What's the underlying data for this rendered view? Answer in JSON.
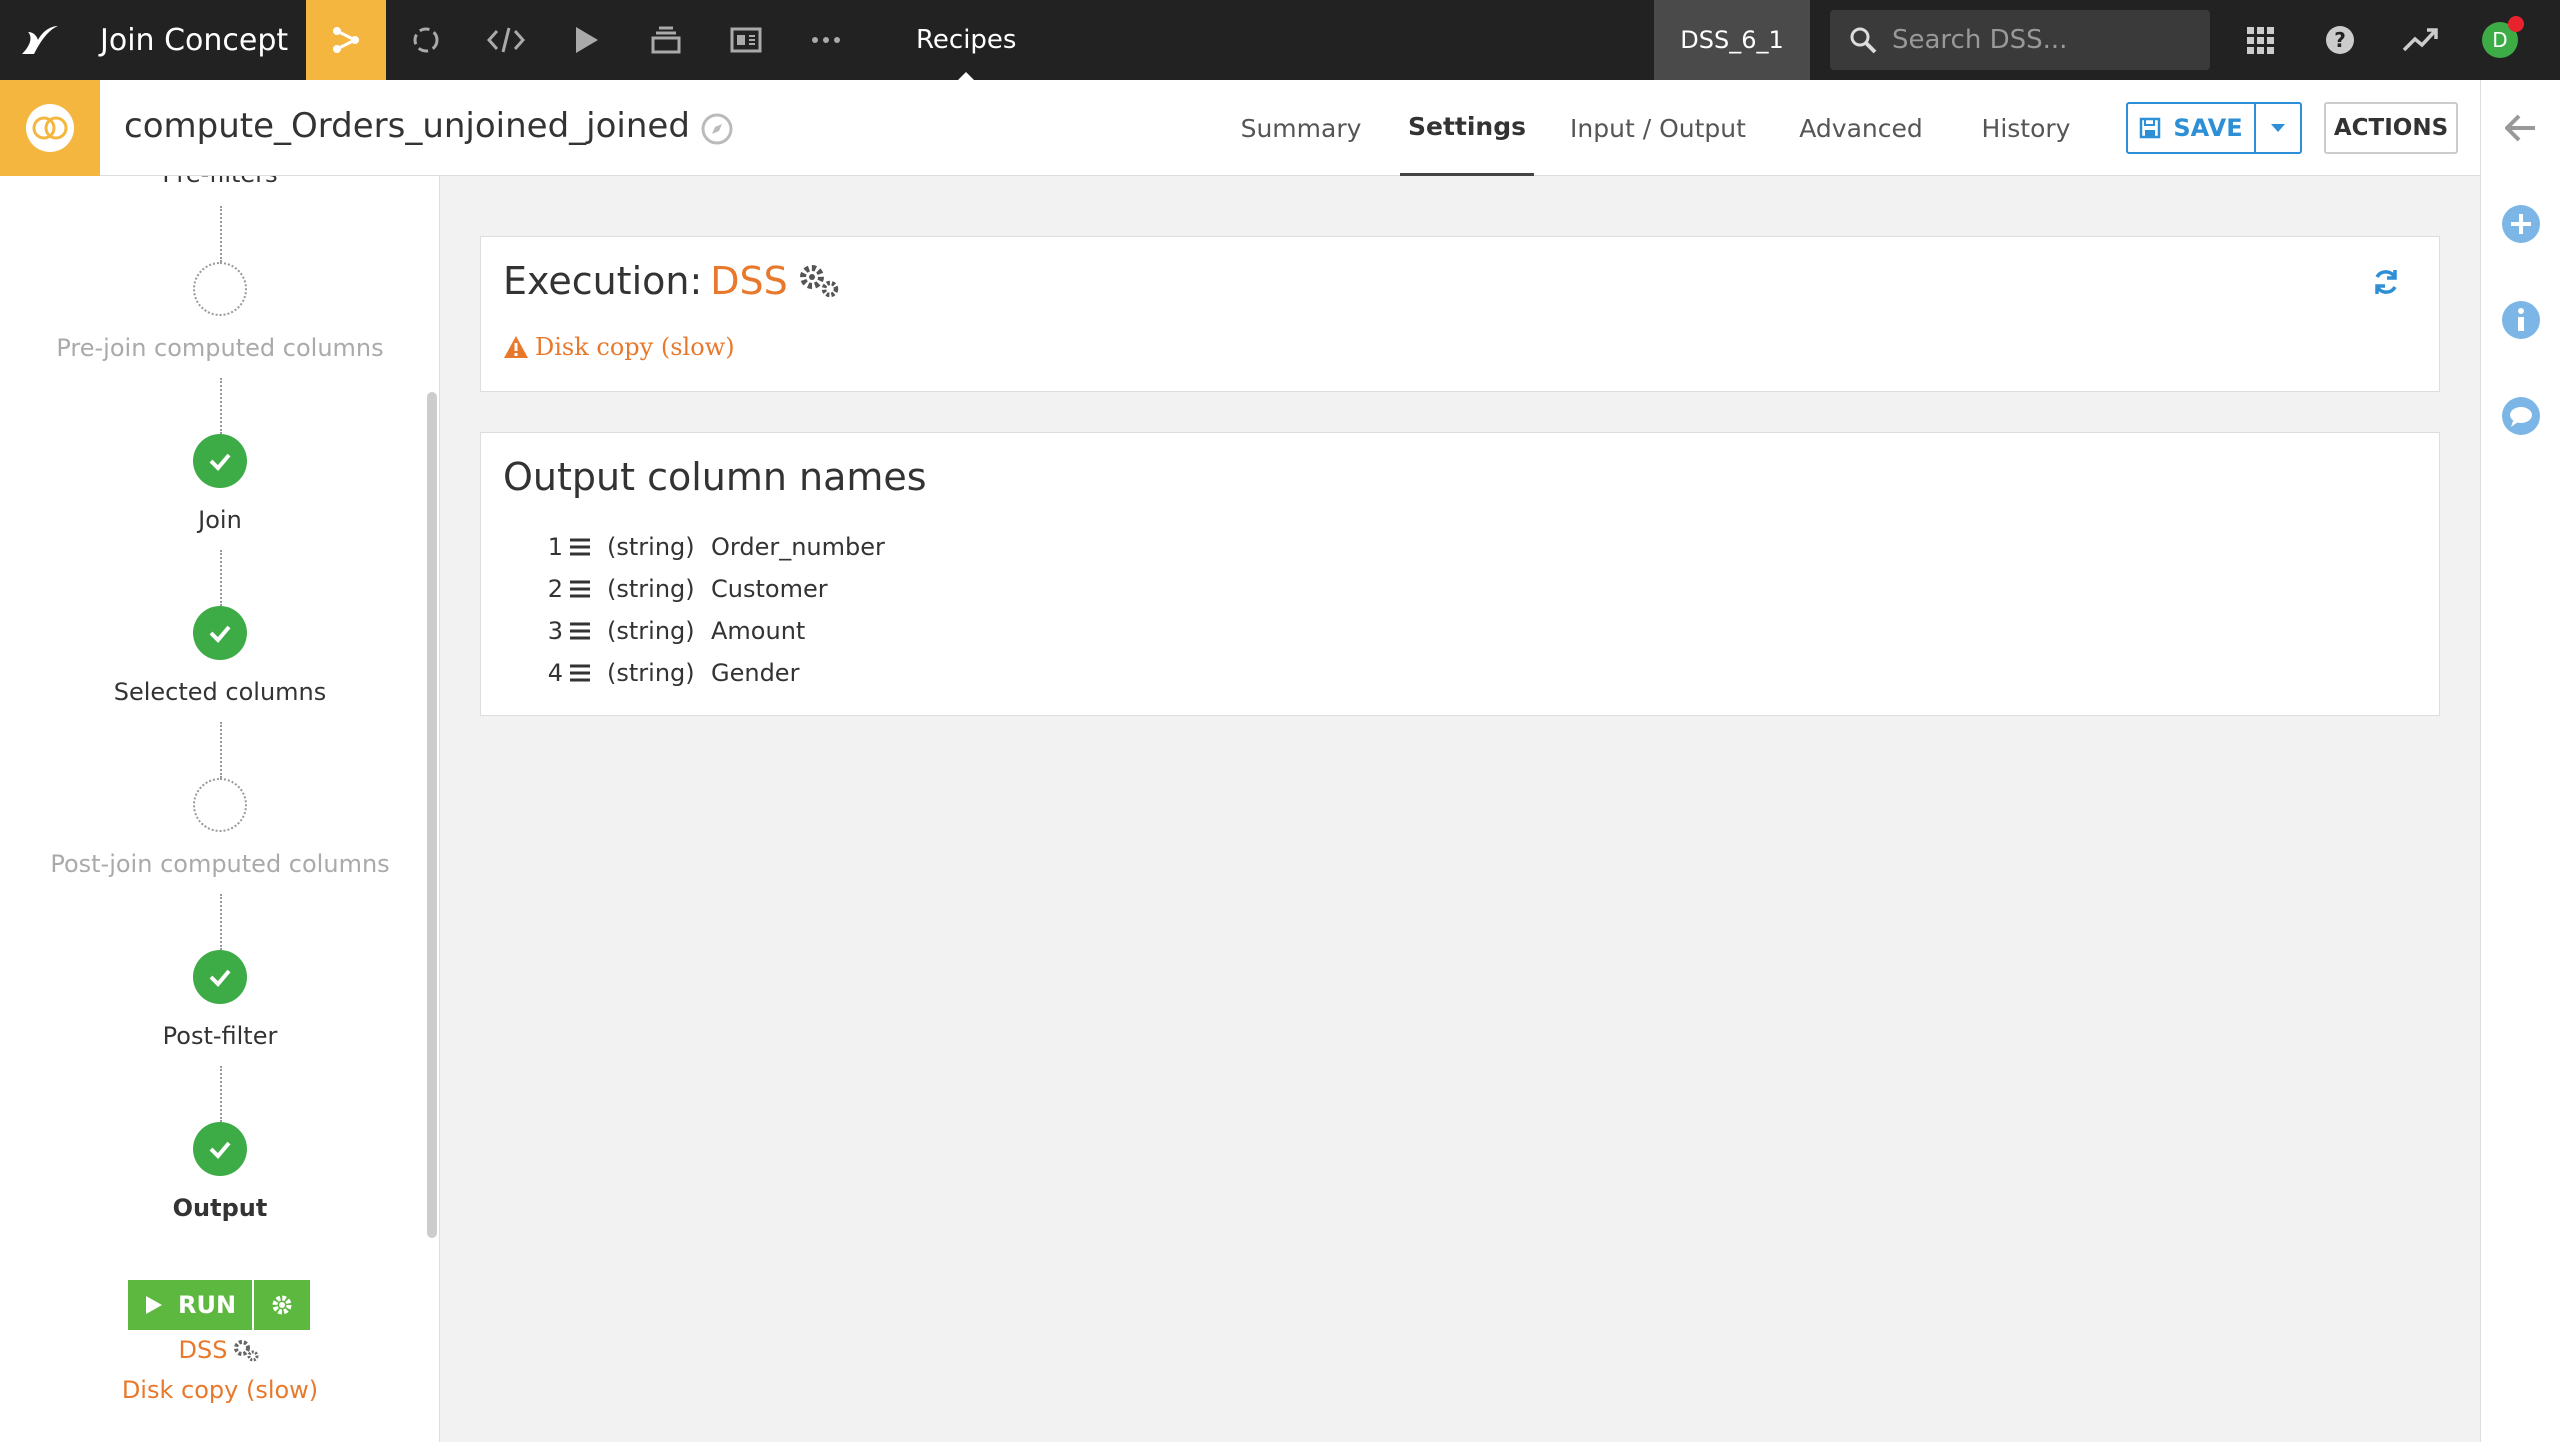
{
  "topnav": {
    "project_title": "Join Concept",
    "section": "Recipes",
    "instance": "DSS_6_1",
    "search_placeholder": "Search DSS...",
    "avatar_initial": "D"
  },
  "recipe": {
    "name": "compute_Orders_unjoined_joined",
    "tabs": [
      "Summary",
      "Settings",
      "Input / Output",
      "Advanced",
      "History"
    ],
    "active_tab": "Settings",
    "save_label": "SAVE",
    "actions_label": "ACTIONS"
  },
  "steps": [
    {
      "label": "Pre-filters",
      "state": "partial"
    },
    {
      "label": "Pre-join computed columns",
      "state": "empty"
    },
    {
      "label": "Join",
      "state": "done"
    },
    {
      "label": "Selected columns",
      "state": "done"
    },
    {
      "label": "Post-join computed columns",
      "state": "empty"
    },
    {
      "label": "Post-filter",
      "state": "done"
    },
    {
      "label": "Output",
      "state": "done",
      "selected": true
    }
  ],
  "run": {
    "label": "RUN",
    "engine": "DSS",
    "engine_note": "Disk copy (slow)"
  },
  "execution": {
    "title_prefix": "Execution:",
    "engine": "DSS",
    "warning": "Disk copy (slow)"
  },
  "output": {
    "title": "Output column names",
    "columns": [
      {
        "index": "1",
        "type": "(string)",
        "name": "Order_number"
      },
      {
        "index": "2",
        "type": "(string)",
        "name": "Customer"
      },
      {
        "index": "3",
        "type": "(string)",
        "name": "Amount"
      },
      {
        "index": "4",
        "type": "(string)",
        "name": "Gender"
      }
    ]
  },
  "colors": {
    "accent": "#f4b63e",
    "engine_orange": "#e8792c",
    "step_done": "#3dab46",
    "save_blue": "#2d8fd6",
    "run_green": "#5cb83e"
  },
  "icons": [
    "flow-icon",
    "lab-icon",
    "code-icon",
    "run-icon",
    "jobs-icon",
    "dashboard-icon",
    "more-icon",
    "search-icon",
    "apps-grid-icon",
    "help-icon",
    "activity-icon",
    "back-arrow-icon",
    "plus-icon",
    "info-icon",
    "chat-icon",
    "refresh-icon",
    "warning-icon",
    "gears-icon",
    "list-icon",
    "check-icon"
  ]
}
